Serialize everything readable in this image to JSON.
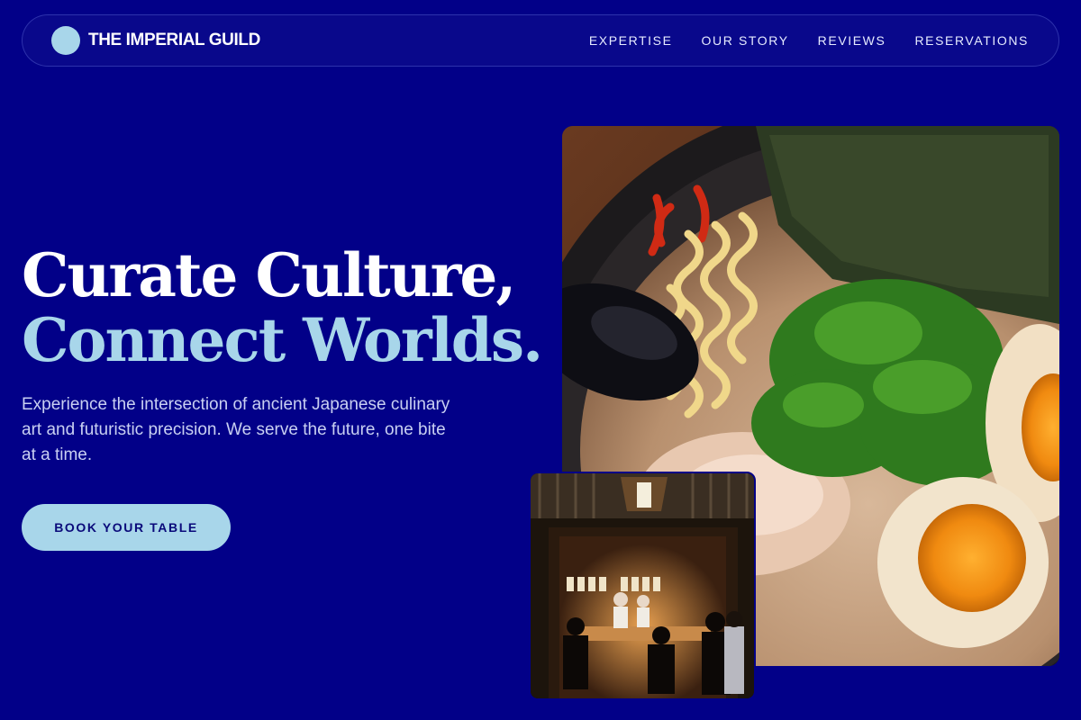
{
  "brand": {
    "name": "THE IMPERIAL GUILD",
    "accent": "#a8d6ea",
    "background": "#020088"
  },
  "nav": {
    "links": [
      {
        "label": "EXPERTISE"
      },
      {
        "label": "OUR STORY"
      },
      {
        "label": "REVIEWS"
      },
      {
        "label": "RESERVATIONS"
      }
    ]
  },
  "hero": {
    "headline_line1": "Curate Culture,",
    "headline_line2": "Connect Worlds.",
    "subtext": "Experience the intersection of ancient Japanese culinary art and futuristic precision. We serve the future, one bite at a time.",
    "cta_label": "BOOK YOUR TABLE"
  },
  "images": {
    "main": {
      "description": "Bowl of ramen with noodles, spinach, nori and a soft-boiled egg"
    },
    "secondary": {
      "description": "Interior of a small Japanese restaurant with chefs at the counter"
    }
  }
}
